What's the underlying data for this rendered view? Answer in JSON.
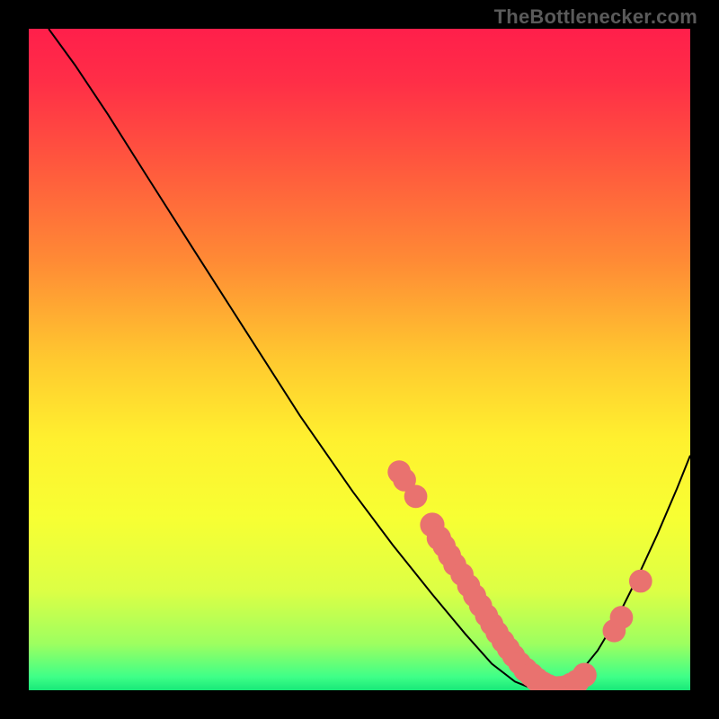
{
  "watermark": "TheBottlenecker.com",
  "gradient": {
    "stops": [
      {
        "offset": 0.0,
        "color": "#ff1f4b"
      },
      {
        "offset": 0.08,
        "color": "#ff2e47"
      },
      {
        "offset": 0.2,
        "color": "#ff563e"
      },
      {
        "offset": 0.35,
        "color": "#ff8a35"
      },
      {
        "offset": 0.5,
        "color": "#ffc92f"
      },
      {
        "offset": 0.62,
        "color": "#fff02f"
      },
      {
        "offset": 0.74,
        "color": "#f7ff33"
      },
      {
        "offset": 0.85,
        "color": "#dcff45"
      },
      {
        "offset": 0.93,
        "color": "#9dff60"
      },
      {
        "offset": 0.98,
        "color": "#3eff88"
      },
      {
        "offset": 1.0,
        "color": "#18e878"
      }
    ]
  },
  "chart_data": {
    "type": "line",
    "title": "",
    "xlabel": "",
    "ylabel": "",
    "xlim": [
      0,
      100
    ],
    "ylim": [
      0,
      100
    ],
    "curve": [
      {
        "x": 3.0,
        "y": 100.0
      },
      {
        "x": 7.0,
        "y": 94.5
      },
      {
        "x": 12.0,
        "y": 87.0
      },
      {
        "x": 18.0,
        "y": 77.5
      },
      {
        "x": 25.0,
        "y": 66.5
      },
      {
        "x": 33.0,
        "y": 54.0
      },
      {
        "x": 41.0,
        "y": 41.5
      },
      {
        "x": 49.0,
        "y": 30.0
      },
      {
        "x": 55.0,
        "y": 22.0
      },
      {
        "x": 61.0,
        "y": 14.5
      },
      {
        "x": 66.0,
        "y": 8.5
      },
      {
        "x": 70.0,
        "y": 4.0
      },
      {
        "x": 73.5,
        "y": 1.3
      },
      {
        "x": 76.0,
        "y": 0.3
      },
      {
        "x": 78.0,
        "y": 0.0
      },
      {
        "x": 80.5,
        "y": 0.5
      },
      {
        "x": 83.0,
        "y": 2.3
      },
      {
        "x": 86.0,
        "y": 6.0
      },
      {
        "x": 89.0,
        "y": 11.0
      },
      {
        "x": 92.0,
        "y": 17.0
      },
      {
        "x": 95.0,
        "y": 23.5
      },
      {
        "x": 98.0,
        "y": 30.5
      },
      {
        "x": 100.0,
        "y": 35.5
      }
    ],
    "markers": [
      {
        "x": 56.0,
        "y": 33.0,
        "r": 1.0
      },
      {
        "x": 56.8,
        "y": 31.8,
        "r": 1.0
      },
      {
        "x": 58.5,
        "y": 29.3,
        "r": 1.0
      },
      {
        "x": 61.0,
        "y": 25.0,
        "r": 1.1
      },
      {
        "x": 62.0,
        "y": 23.0,
        "r": 1.1
      },
      {
        "x": 62.8,
        "y": 21.8,
        "r": 1.0
      },
      {
        "x": 63.6,
        "y": 20.4,
        "r": 1.0
      },
      {
        "x": 64.4,
        "y": 19.0,
        "r": 1.0
      },
      {
        "x": 65.5,
        "y": 17.5,
        "r": 1.0
      },
      {
        "x": 66.5,
        "y": 15.8,
        "r": 1.0
      },
      {
        "x": 67.4,
        "y": 14.3,
        "r": 1.0
      },
      {
        "x": 68.3,
        "y": 12.8,
        "r": 1.0
      },
      {
        "x": 69.2,
        "y": 11.3,
        "r": 1.0
      },
      {
        "x": 70.0,
        "y": 10.0,
        "r": 1.0
      },
      {
        "x": 70.8,
        "y": 8.7,
        "r": 1.0
      },
      {
        "x": 71.7,
        "y": 7.4,
        "r": 1.0
      },
      {
        "x": 72.5,
        "y": 6.3,
        "r": 1.0
      },
      {
        "x": 73.3,
        "y": 5.2,
        "r": 1.0
      },
      {
        "x": 74.2,
        "y": 4.1,
        "r": 1.0
      },
      {
        "x": 75.1,
        "y": 3.1,
        "r": 1.1
      },
      {
        "x": 76.0,
        "y": 2.3,
        "r": 1.1
      },
      {
        "x": 76.8,
        "y": 1.6,
        "r": 1.1
      },
      {
        "x": 77.7,
        "y": 1.0,
        "r": 1.1
      },
      {
        "x": 78.5,
        "y": 0.6,
        "r": 1.1
      },
      {
        "x": 79.4,
        "y": 0.3,
        "r": 1.1
      },
      {
        "x": 80.2,
        "y": 0.3,
        "r": 1.1
      },
      {
        "x": 81.0,
        "y": 0.4,
        "r": 1.1
      },
      {
        "x": 82.0,
        "y": 0.8,
        "r": 1.1
      },
      {
        "x": 82.9,
        "y": 1.3,
        "r": 1.1
      },
      {
        "x": 84.0,
        "y": 2.3,
        "r": 1.1
      },
      {
        "x": 88.5,
        "y": 9.0,
        "r": 1.0
      },
      {
        "x": 89.6,
        "y": 11.0,
        "r": 1.0
      },
      {
        "x": 92.5,
        "y": 16.5,
        "r": 1.0
      }
    ],
    "marker_color": "#e9726f",
    "curve_color": "#000000"
  }
}
